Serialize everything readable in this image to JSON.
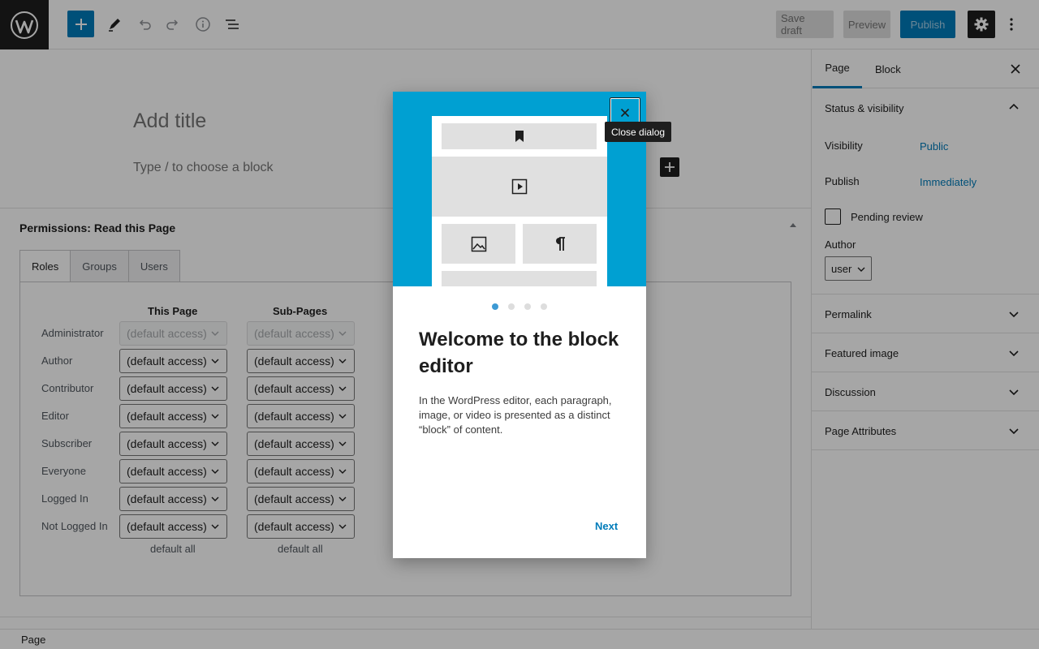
{
  "toolbar": {
    "save_draft": "Save draft",
    "preview": "Preview",
    "publish": "Publish"
  },
  "editor": {
    "title_placeholder": "Add title",
    "block_placeholder": "Type / to choose a block"
  },
  "permissions": {
    "title": "Permissions: Read this Page",
    "tabs": [
      "Roles",
      "Groups",
      "Users"
    ],
    "active_tab": "Roles",
    "columns": [
      "This Page",
      "Sub-Pages"
    ],
    "rows": [
      {
        "role": "Administrator",
        "this_page": "(default access)",
        "sub_pages": "(default access)",
        "disabled": true
      },
      {
        "role": "Author",
        "this_page": "(default access)",
        "sub_pages": "(default access)"
      },
      {
        "role": "Contributor",
        "this_page": "(default access)",
        "sub_pages": "(default access)"
      },
      {
        "role": "Editor",
        "this_page": "(default access)",
        "sub_pages": "(default access)"
      },
      {
        "role": "Subscriber",
        "this_page": "(default access)",
        "sub_pages": "(default access)"
      },
      {
        "role": "Everyone",
        "this_page": "(default access)",
        "sub_pages": "(default access)"
      },
      {
        "role": "Logged In",
        "this_page": "(default access)",
        "sub_pages": "(default access)"
      },
      {
        "role": "Not Logged In",
        "this_page": "(default access)",
        "sub_pages": "(default access)"
      }
    ],
    "default_all": "default all"
  },
  "sidebar": {
    "tabs": {
      "page": "Page",
      "block": "Block"
    },
    "status_visibility": {
      "title": "Status & visibility",
      "visibility_label": "Visibility",
      "visibility_value": "Public",
      "publish_label": "Publish",
      "publish_value": "Immediately",
      "pending_review": "Pending review",
      "author_label": "Author",
      "author_value": "user"
    },
    "panels": [
      "Permalink",
      "Featured image",
      "Discussion",
      "Page Attributes"
    ]
  },
  "footer": {
    "breadcrumb": "Page"
  },
  "modal": {
    "close_tooltip": "Close dialog",
    "heading": "Welcome to the block editor",
    "body": "In the WordPress editor, each paragraph, image, or video is presented as a distinct “block” of content.",
    "next": "Next",
    "page_count": 4,
    "current_page": 1
  },
  "colors": {
    "accent": "#007cba",
    "hero_bg": "#00a0d2",
    "dark": "#1e1e1e"
  },
  "icons": [
    "wordpress-logo-icon",
    "plus-icon",
    "pencil-icon",
    "undo-icon",
    "redo-icon",
    "info-icon",
    "list-view-icon",
    "gear-icon",
    "more-vertical-icon",
    "close-icon",
    "chevron-up-icon",
    "chevron-down-icon",
    "bookmark-icon",
    "video-icon",
    "image-icon",
    "pilcrow-icon"
  ]
}
